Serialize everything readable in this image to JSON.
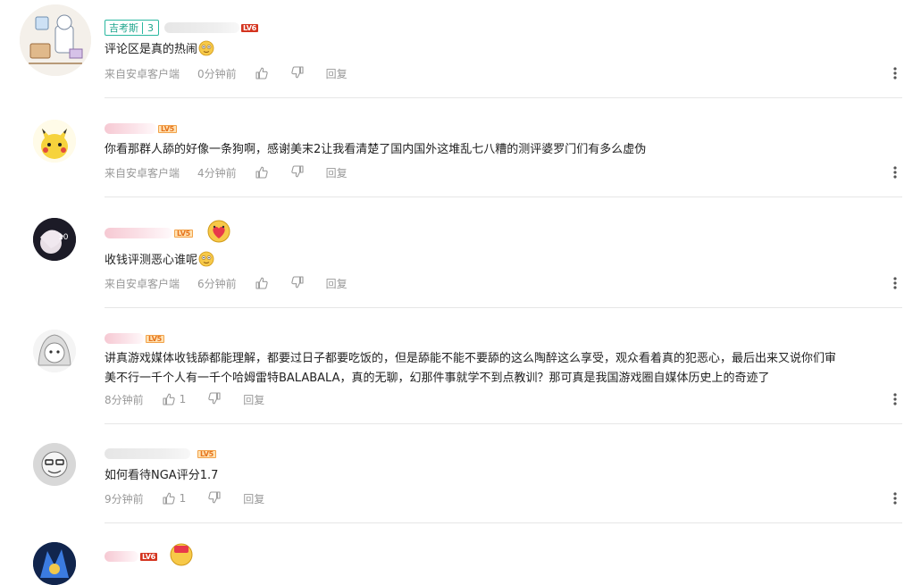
{
  "comments": [
    {
      "level": "LV6",
      "badge": {
        "name": "吉考斯",
        "level": "3"
      },
      "text": "评论区是真的热闹",
      "source": "来自安卓客户端",
      "time": "0分钟前",
      "like_count": "",
      "reply": "回复"
    },
    {
      "level": "LV5",
      "text": "你看那群人舔的好像一条狗啊，感谢美末2让我看清楚了国内国外这堆乱七八糟的测评婆罗门们有多么虚伪",
      "source": "来自安卓客户端",
      "time": "4分钟前",
      "like_count": "",
      "reply": "回复"
    },
    {
      "level": "LV5",
      "text": "收钱评测恶心谁呢",
      "source": "来自安卓客户端",
      "time": "6分钟前",
      "like_count": "",
      "reply": "回复"
    },
    {
      "level": "LV5",
      "text_line1": "讲真游戏媒体收钱舔都能理解，都要过日子都要吃饭的，但是舔能不能不要舔的这么陶醉这么享受，观众看着真的犯恶心，最后出来又说你们审",
      "text_line2": "美不行一千个人有一千个哈姆雷特BALABALA，真的无聊，幻那件事就学不到点教训？那可真是我国游戏圈自媒体历史上的奇迹了",
      "source": "",
      "time": "8分钟前",
      "like_count": "1",
      "reply": "回复"
    },
    {
      "level": "LV5",
      "text": "如何看待NGA评分1.7",
      "source": "",
      "time": "9分钟前",
      "like_count": "1",
      "reply": "回复"
    },
    {
      "level": "LV6"
    }
  ],
  "colors": {
    "text": "#222222",
    "meta": "#999999",
    "divider": "#e6e6e6",
    "badge": "#1fa58d",
    "level_red": "#d4341f",
    "level_orange": "#e6731c"
  },
  "icons": {
    "like": "thumbs-up-icon",
    "dislike": "thumbs-down-icon",
    "more": "more-vertical-icon"
  }
}
